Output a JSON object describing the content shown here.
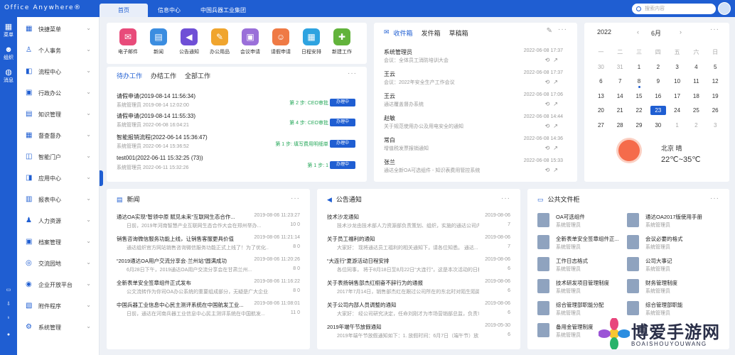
{
  "app": {
    "logo": "Office Anywhere®",
    "search_placeholder": "搜索内容"
  },
  "top_tabs": [
    "首页",
    "信息中心",
    "中国兵器工业集团"
  ],
  "rail": [
    {
      "label": "菜单",
      "icon": "grid-icon"
    },
    {
      "label": "组织",
      "icon": "people-icon"
    },
    {
      "label": "消息",
      "icon": "chat-icon"
    }
  ],
  "sidebar": [
    "快捷菜单",
    "个人事务",
    "流程中心",
    "行政办公",
    "知识管理",
    "督查督办",
    "智能门户",
    "应用中心",
    "报表中心",
    "人力资源",
    "档案管理",
    "交流园地",
    "企业开放平台",
    "附件程序",
    "系统管理"
  ],
  "apps": [
    {
      "label": "电子邮件",
      "icon": "mail-icon",
      "color": "#e84b7a"
    },
    {
      "label": "新闻",
      "icon": "news-icon",
      "color": "#3b8de0"
    },
    {
      "label": "公告通知",
      "icon": "speaker-icon",
      "color": "#6f4fd6"
    },
    {
      "label": "办公用品",
      "icon": "supplies-icon",
      "color": "#f0a52e"
    },
    {
      "label": "会议申请",
      "icon": "meeting-icon",
      "color": "#9a6fd9"
    },
    {
      "label": "请假申请",
      "icon": "leave-icon",
      "color": "#ef7a45"
    },
    {
      "label": "日程安排",
      "icon": "calendar-icon",
      "color": "#2ea3e0"
    },
    {
      "label": "新建工作",
      "icon": "new-work-icon",
      "color": "#62b33b"
    }
  ],
  "todo": {
    "tabs": [
      "待办工作",
      "办结工作",
      "全部工作"
    ],
    "rows": [
      {
        "title": "请假申请(2019-08-14 11:56:34)",
        "sub": "系统管理员  2019-08-14 12:02:00",
        "step": "第 2 步: CEO审批",
        "btn": "办理中"
      },
      {
        "title": "请假申请(2019-08-14 11:55:33)",
        "sub": "系统管理员  2022-06-08 16:04:21",
        "step": "第 4 步: CEO审批",
        "btn": "办理中"
      },
      {
        "title": "智能报销流程(2022-06-14 15:36:47)",
        "sub": "系统管理员  2022-06-14 15:36:52",
        "step": "第 1 步: 填写费用明细单",
        "btn": "办理中"
      },
      {
        "title": "test001(2022-06-11 15:32:25 (73))",
        "sub": "系统管理员  2022-06-11 15:32:26",
        "step": "第 1 步: 1",
        "btn": "办理中"
      }
    ]
  },
  "mail": {
    "tabs": [
      "收件箱",
      "发件箱",
      "草稿箱"
    ],
    "rows": [
      {
        "from": "系统管理员",
        "sub": "会议：全体员工消防培训大会",
        "time": "2022-06-08 17:37"
      },
      {
        "from": "王云",
        "sub": "会议：2022年安全生产工作会议",
        "time": "2022-06-08 17:37"
      },
      {
        "from": "王云",
        "sub": "通达覆盖督办系统",
        "time": "2022-06-08 17:06"
      },
      {
        "from": "赵敏",
        "sub": "关于规范使用办公及用电安全的通知",
        "time": "2022-06-08 14:44"
      },
      {
        "from": "常白",
        "sub": "增值税发票报销通知",
        "time": "2022-06-08 14:36"
      },
      {
        "from": "张兰",
        "sub": "通达全新OA可选组件 - 知识表费用管控系统",
        "time": "2022-06-08 15:33"
      }
    ]
  },
  "calendar": {
    "year": "2022",
    "month": "6月",
    "weekdays": [
      "一",
      "二",
      "三",
      "四",
      "五",
      "六",
      "日"
    ],
    "weeks": [
      [
        "30",
        "31",
        "1",
        "2",
        "3",
        "4",
        "5"
      ],
      [
        "6",
        "7",
        "8",
        "9",
        "10",
        "11",
        "12"
      ],
      [
        "13",
        "14",
        "15",
        "16",
        "17",
        "18",
        "19"
      ],
      [
        "20",
        "21",
        "22",
        "23",
        "24",
        "25",
        "26"
      ],
      [
        "27",
        "28",
        "29",
        "30",
        "1",
        "2",
        "3"
      ]
    ],
    "today": "23",
    "weather_city": "北京 晴",
    "weather_temp": "22℃~35℃"
  },
  "news": {
    "title": "新闻",
    "rows": [
      {
        "title": "通达OA实现“智领中原 赋见未来”互联网生态合作...",
        "date": "2019-08-06 11:23:27",
        "sub": "日前，2019年河南智慧产业互联网生态合作大会在郑州举办...",
        "stats": "10  0"
      },
      {
        "title": "销售咨询微信服务功能上线，让销售客服更具价值",
        "date": "2019-08-06 11:21:14",
        "sub": "通达组织官方网站销售咨询微信服务功能正式上线了！为了优化...",
        "stats": "8  0"
      },
      {
        "title": "“2019通达OA用户交流分享会·兰州站”圆满成功",
        "date": "2019-08-06 11:20:26",
        "sub": "6月28日下午，2019通达OA用户交流分享会在甘肃兰州...",
        "stats": "8  0"
      },
      {
        "title": "全新表单安全签章组件正式发布",
        "date": "2019-08-06 11:16:22",
        "sub": "公文流转作为你司OA办公系统的重要组成部分，无疑是广大企业...",
        "stats": "8  0"
      },
      {
        "title": "中国兵器工业信息中心民主测评系统在中国航发工业...",
        "date": "2019-08-06 11:08:01",
        "sub": "日前，通达在河南兵器工业信息中心民主测评系统在中国航发...",
        "stats": "11  0"
      }
    ]
  },
  "notice": {
    "title": "公告通知",
    "rows": [
      {
        "title": "技术沙龙通知",
        "date": "2019-08-06",
        "sub": "技术沙龙由技术部人力资源部负责策划、组织，实施的通达公司内部技术...",
        "stats": "7"
      },
      {
        "title": "关于员工福利的通知",
        "date": "2019-08-06",
        "sub": "大家好：    现将通达员工福利的相关通知下，请各位知悉。     通达...",
        "stats": "7"
      },
      {
        "title": "“大连行”夏游活动日程安排",
        "date": "2019-08-06",
        "sub": "各位同事，    将于8月18日至8月22日“大连行”，这是本次活动的日程及注意事...",
        "stats": "6"
      },
      {
        "title": "关于表扬销售部杰红栩奋不辞行为的通报",
        "date": "2019-08-06",
        "sub": "2017年7月14日，销售部杰红在跟过公司所在的东北时对陌生陌路旅客...",
        "stats": "6"
      },
      {
        "title": "关于公司内部人员调整的通知",
        "date": "2019-08-06",
        "sub": "大家好：    经公司研究决定，任命刘刚才为市场营销部总监，负责市场营...",
        "stats": "6"
      },
      {
        "title": "2019年端午节放假通知",
        "date": "2019-05-30",
        "sub": "2019年端午节放假通知如下：1. 放假时间：6月7日（端午节）放...",
        "stats": "6"
      }
    ]
  },
  "files": {
    "title": "公共文件柜",
    "items": [
      {
        "name": "OA可选组件",
        "sub": "系统管理员"
      },
      {
        "name": "通达OA2017版使用手册",
        "sub": "系统管理员"
      },
      {
        "name": "全新表单安全签章组件正...",
        "sub": "系统管理员"
      },
      {
        "name": "会议必要的格式",
        "sub": "系统管理员"
      },
      {
        "name": "工作日志格式",
        "sub": "系统管理员"
      },
      {
        "name": "公司大事记",
        "sub": "系统管理员"
      },
      {
        "name": "技术研发项目管理制度",
        "sub": "系统管理员"
      },
      {
        "name": "财务管理制度",
        "sub": "系统管理员"
      },
      {
        "name": "综合管理部职能分配",
        "sub": "系统管理员"
      },
      {
        "name": "综合管理部职能",
        "sub": "系统管理员"
      },
      {
        "name": "备用金管理制度",
        "sub": "系统管理员"
      },
      {
        "name": "",
        "sub": ""
      }
    ]
  },
  "watermark": {
    "big": "博爱手游网",
    "small": "BOAISHOUYOUWANG"
  }
}
